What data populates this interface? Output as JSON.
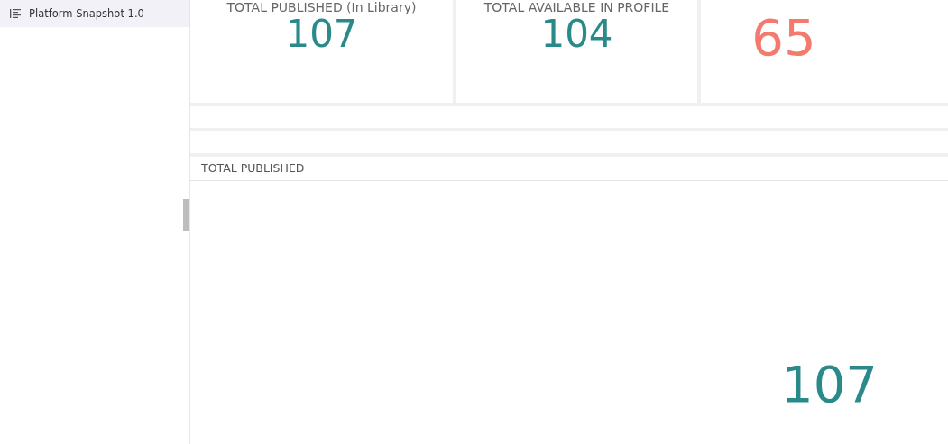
{
  "sidebar": {
    "items": [
      {
        "label": "Platform Snapshot 1.0",
        "selected": true
      }
    ]
  },
  "cards": [
    {
      "label": "TOTAL PUBLISHED (In Library)",
      "value": "107",
      "color": "#2a8a8a"
    },
    {
      "label": "TOTAL AVAILABLE IN PROFILE",
      "value": "104",
      "color": "#2a8a8a"
    },
    {
      "value": "65",
      "color": "#f47a70"
    }
  ],
  "panels": [
    {
      "title": "TOTAL PUBLISHED",
      "value": "107"
    }
  ]
}
